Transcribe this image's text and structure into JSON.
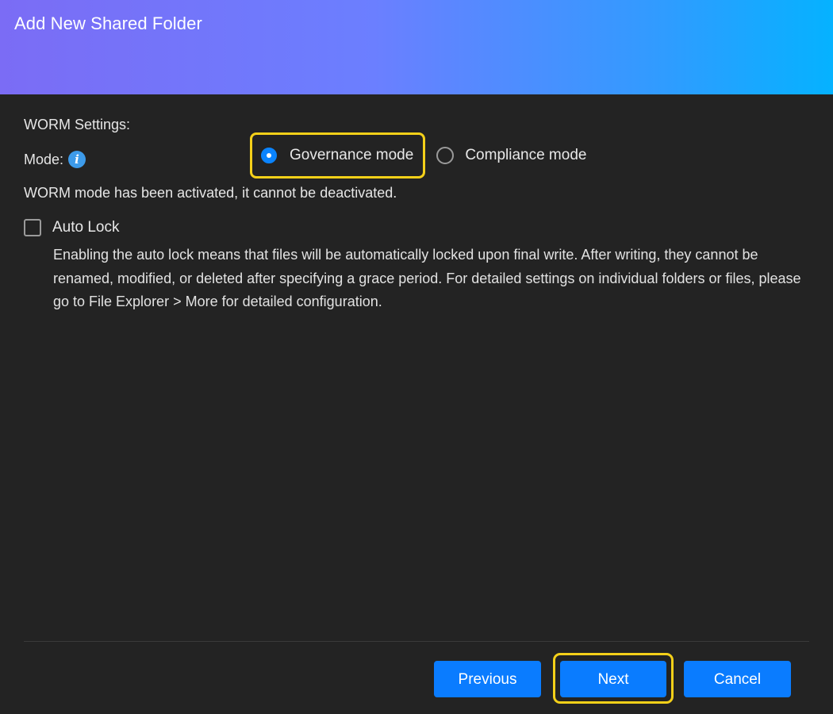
{
  "dialog": {
    "title": "Add New Shared Folder"
  },
  "worm": {
    "section_label": "WORM Settings:",
    "mode_label": "Mode:",
    "info_icon": "info-icon",
    "info_glyph": "i",
    "modes": [
      {
        "label": "Governance mode",
        "selected": true
      },
      {
        "label": "Compliance mode",
        "selected": false
      }
    ],
    "notice": "WORM mode has been activated, it cannot be deactivated."
  },
  "auto_lock": {
    "label": "Auto Lock",
    "checked": false,
    "description": "Enabling the auto lock means that files will be automatically locked upon final write. After writing, they cannot be renamed, modified, or deleted after specifying a grace period. For detailed settings on individual folders or files, please go to File Explorer > More for detailed configuration."
  },
  "footer": {
    "previous_label": "Previous",
    "next_label": "Next",
    "cancel_label": "Cancel"
  },
  "colors": {
    "accent": "#0a7cff",
    "highlight": "#f4d019",
    "background": "#232323",
    "header_gradient_start": "#7b6cf5",
    "header_gradient_end": "#05b2ff"
  }
}
